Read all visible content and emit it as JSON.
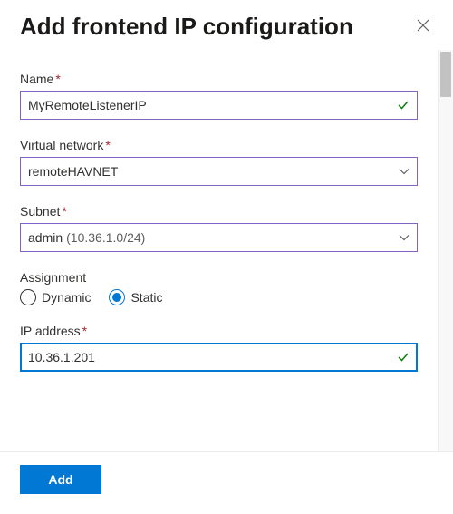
{
  "header": {
    "title": "Add frontend IP configuration"
  },
  "fields": {
    "name": {
      "label": "Name",
      "required": true,
      "value": "MyRemoteListenerIP",
      "validated": true
    },
    "vnet": {
      "label": "Virtual network",
      "required": true,
      "value": "remoteHAVNET"
    },
    "subnet": {
      "label": "Subnet",
      "required": true,
      "value": "admin",
      "hint": "(10.36.1.0/24)"
    },
    "assignment": {
      "label": "Assignment",
      "options": [
        "Dynamic",
        "Static"
      ],
      "selected": "Static"
    },
    "ip": {
      "label": "IP address",
      "required": true,
      "value": "10.36.1.201",
      "validated": true,
      "focused": true
    }
  },
  "footer": {
    "add_label": "Add"
  },
  "required_marker": "*"
}
